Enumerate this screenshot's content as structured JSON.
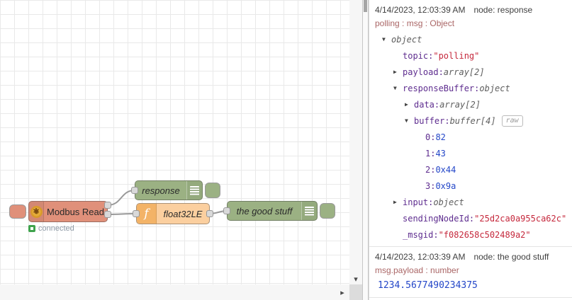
{
  "canvas": {
    "nodes": {
      "modbus": {
        "label": "Modbus Read",
        "status": "connected"
      },
      "response": {
        "label": "response"
      },
      "float32": {
        "label": "float32LE"
      },
      "goodstuff": {
        "label": "the good stuff"
      }
    },
    "colors": {
      "modbus_node": "#E0907A",
      "debug_node": "#9BB183",
      "function_node": "#FBCF9F",
      "status_green": "#3FA34D",
      "wire": "#999999"
    }
  },
  "scrollbars": {
    "down_arrow": "▾",
    "right_arrow": "▸"
  },
  "debug": {
    "messages": [
      {
        "timestamp": "4/14/2023, 12:03:39 AM",
        "node": "node: response",
        "meta": "polling : msg : Object",
        "tree": [
          {
            "level": 0,
            "arrow": "expanded",
            "key": "",
            "value": "object",
            "vtype": "type"
          },
          {
            "level": 1,
            "arrow": "",
            "key": "topic",
            "value": "\"polling\"",
            "vtype": "string"
          },
          {
            "level": 1,
            "arrow": "collapsed",
            "key": "payload",
            "value": "array[2]",
            "vtype": "type"
          },
          {
            "level": 1,
            "arrow": "expanded",
            "key": "responseBuffer",
            "value": "object",
            "vtype": "type"
          },
          {
            "level": 2,
            "arrow": "collapsed",
            "key": "data",
            "value": "array[2]",
            "vtype": "type"
          },
          {
            "level": 2,
            "arrow": "expanded",
            "key": "buffer",
            "value": "buffer[4]",
            "vtype": "type",
            "raw_button": "raw"
          },
          {
            "level": 3,
            "arrow": "",
            "key": "0",
            "value": "82",
            "vtype": "number"
          },
          {
            "level": 3,
            "arrow": "",
            "key": "1",
            "value": "43",
            "vtype": "number"
          },
          {
            "level": 3,
            "arrow": "",
            "key": "2",
            "value": "0x44",
            "vtype": "number"
          },
          {
            "level": 3,
            "arrow": "",
            "key": "3",
            "value": "0x9a",
            "vtype": "number"
          },
          {
            "level": 1,
            "arrow": "collapsed",
            "key": "input",
            "value": "object",
            "vtype": "type"
          },
          {
            "level": 1,
            "arrow": "",
            "key": "sendingNodeId",
            "value": "\"25d2ca0a955ca62c\"",
            "vtype": "string"
          },
          {
            "level": 1,
            "arrow": "",
            "key": "_msgid",
            "value": "\"f082658c502489a2\"",
            "vtype": "string"
          }
        ]
      },
      {
        "timestamp": "4/14/2023, 12:03:39 AM",
        "node": "node: the good stuff",
        "meta": "msg.payload : number",
        "value": "1234.5677490234375"
      }
    ]
  }
}
